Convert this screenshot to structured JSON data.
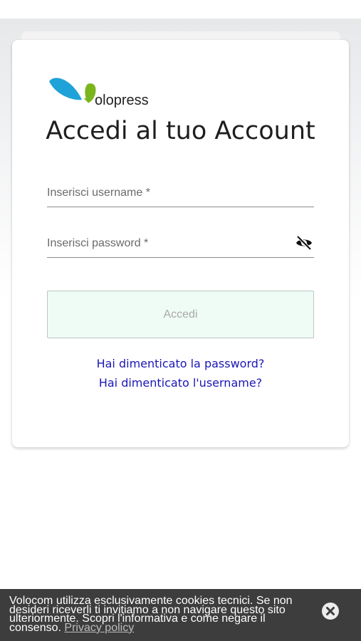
{
  "brand": {
    "logo_text": "olopress",
    "accent_blue": "#1fa2d8",
    "accent_green": "#7ab51d"
  },
  "login": {
    "title": "Accedi al tuo Account",
    "username_placeholder": "Inserisci username *",
    "password_placeholder": "Inserisci password *",
    "toggle_icon": "eye-slash-icon",
    "submit_label": "Accedi",
    "forgot_password": "Hai dimenticato la password?",
    "forgot_username": "Hai dimenticato l'username?"
  },
  "cookie_banner": {
    "message": "Volocom utilizza esclusivamente cookies tecnici. Se non desideri riceverli ti invitiamo a non navigare questo sito ulteriormente. Scopri l'informativa e come negare il consenso.",
    "link_label": "Privacy policy",
    "close_icon": "close-circle-icon"
  }
}
